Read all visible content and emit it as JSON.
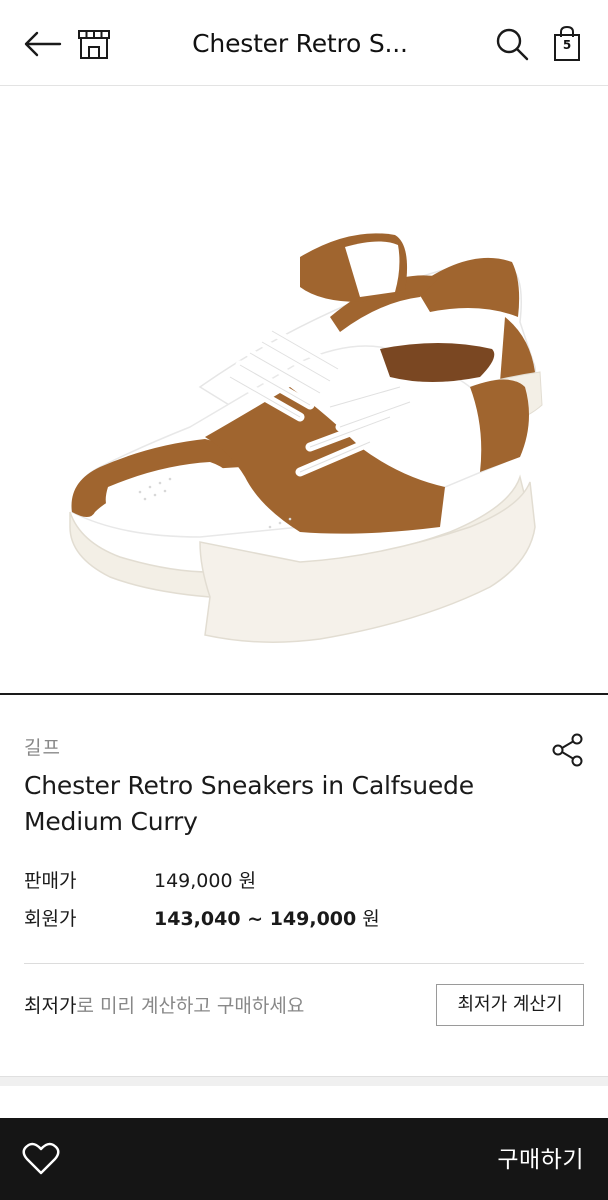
{
  "header": {
    "title": "Chester Retro S...",
    "cart_count": "5",
    "icons": [
      "back-arrow-icon",
      "store-icon",
      "search-icon",
      "shopping-bag-icon"
    ]
  },
  "product": {
    "image_alt": "Chester Retro Sneakers in Calfsuede Medium Curry",
    "brand": "길프",
    "name": "Chester Retro Sneakers in Calfsuede Medium Curry",
    "sale_price_label": "판매가",
    "sale_price": "149,000",
    "member_price_label": "회원가",
    "member_price": "143,040 ~ 149,000",
    "currency_unit": "원",
    "colors": {
      "suede": "#a0652f",
      "leather": "#ffffff",
      "sole": "#f3efe6"
    }
  },
  "lowest_price": {
    "strong_text": "최저가",
    "rest_text": "로 미리 계산하고 구매하세요",
    "button_label": "최저가 계산기"
  },
  "bottom_bar": {
    "buy_label": "구매하기",
    "bg_color": "#151515"
  }
}
